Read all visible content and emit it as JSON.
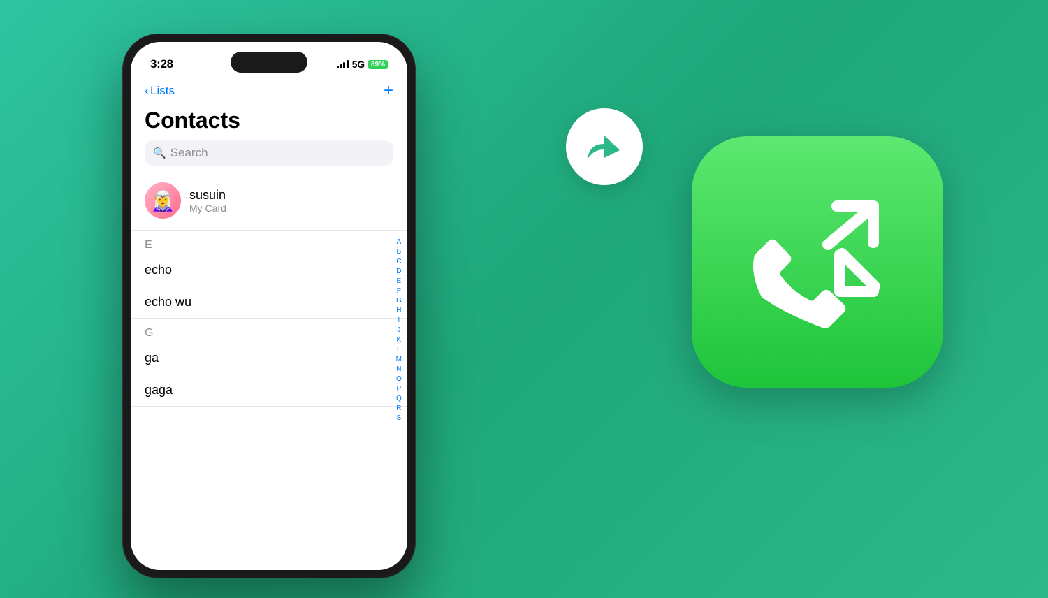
{
  "background_color": "#2db88a",
  "phone": {
    "status_bar": {
      "time": "3:28",
      "signal": "5G",
      "battery": "89%"
    },
    "nav": {
      "back_label": "Lists",
      "add_label": "+"
    },
    "title": "Contacts",
    "search": {
      "placeholder": "Search"
    },
    "my_card": {
      "name": "susuin",
      "subtitle": "My Card",
      "avatar_emoji": "🧝"
    },
    "sections": [
      {
        "header": "E",
        "contacts": [
          "echo",
          "echo wu"
        ]
      },
      {
        "header": "G",
        "contacts": [
          "ga",
          "gaga"
        ]
      }
    ],
    "alphabet": [
      "A",
      "B",
      "C",
      "D",
      "E",
      "F",
      "G",
      "H",
      "I",
      "J",
      "K",
      "L",
      "M",
      "N",
      "O",
      "P",
      "Q",
      "R",
      "S"
    ]
  },
  "app_icon": {
    "gradient_top": "#5de870",
    "gradient_bottom": "#1ec43a"
  },
  "reply_bubble": {
    "color": "#2db88a"
  }
}
